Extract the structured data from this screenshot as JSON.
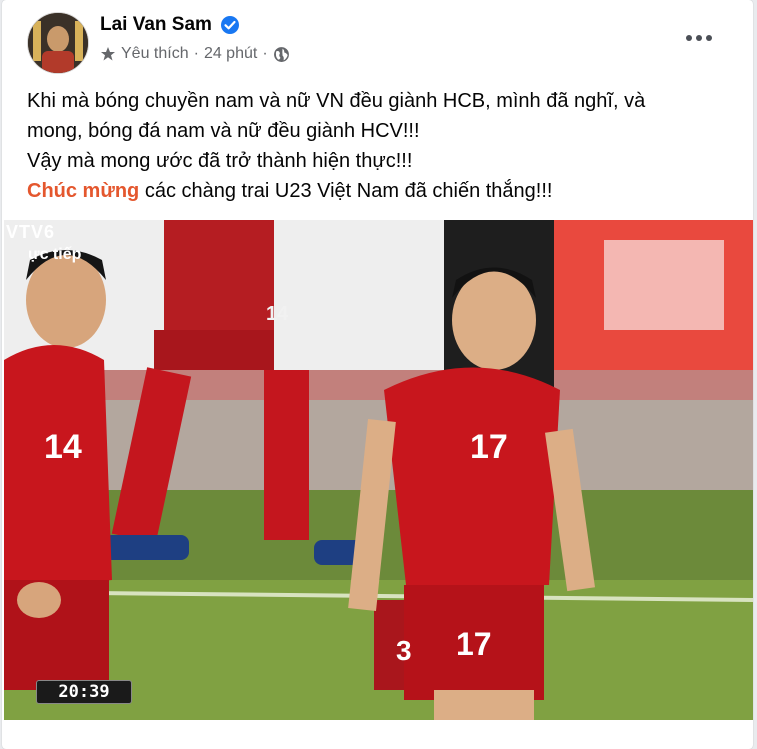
{
  "post": {
    "author": "Lai Van Sam",
    "status": "Yêu thích",
    "separator_1": "·",
    "time": "24 phút",
    "separator_2": "·",
    "text_line_1": "Khi mà bóng chuyền nam và nữ VN đều giành HCB, mình đã nghĩ, và",
    "text_line_2": "mong, bóng đá nam và nữ đều giành HCV!!!",
    "text_line_3": "Vậy mà mong ước đã trở thành hiện thực!!!",
    "text_highlight": "Chúc mừng",
    "text_line_4_rest": " các chàng trai U23 Việt Nam đã chiến thắng!!!"
  },
  "photo": {
    "channel_logo": "VTV6",
    "live_label": "ực tiếp",
    "timer": "20:39",
    "jersey_left": "14",
    "jersey_center": "17",
    "shorts_center": "17",
    "shorts_partial": "3",
    "shorts_back": "14"
  },
  "icons": {
    "verified": "verified-badge-icon",
    "star": "star-icon",
    "globe": "globe-icon",
    "more": "more-options-icon"
  },
  "colors": {
    "highlight": "#e4572e",
    "verified": "#1877f2",
    "jersey": "#c8161d"
  }
}
